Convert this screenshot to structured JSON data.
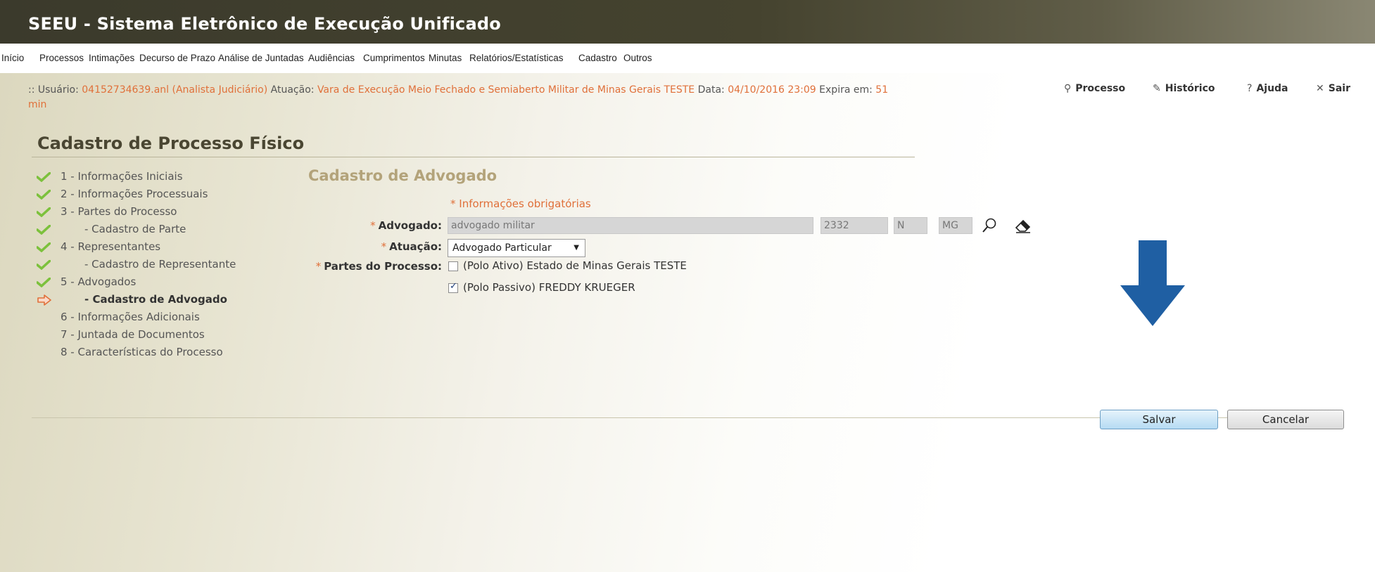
{
  "app": {
    "title": "SEEU - Sistema Eletrônico de Execução Unificado"
  },
  "menu": [
    "Início",
    "Processos",
    "Intimações",
    "Decurso de Prazo",
    "Análise de Juntadas",
    "Audiências",
    "Cumprimentos",
    "Minutas",
    "Relatórios/Estatísticas",
    "Cadastro",
    "Outros"
  ],
  "userbar": {
    "prefix": ":: Usuário:",
    "user": "04152734639.anl (Analista Judiciário)",
    "atuacao_label": "Atuação:",
    "atuacao": "Vara de Execução Meio Fechado e Semiaberto Militar de Minas Gerais TESTE",
    "data_label": "Data:",
    "data": "04/10/2016 23:09",
    "expira_label": "Expira em:",
    "expira": "51",
    "min": "min",
    "links": {
      "processo": "Processo",
      "historico": "Histórico",
      "ajuda": "Ajuda",
      "sair": "Sair"
    }
  },
  "page_title": "Cadastro de Processo Físico",
  "steps": [
    {
      "label": "1 - Informações Iniciais",
      "status": "done"
    },
    {
      "label": "2 - Informações Processuais",
      "status": "done"
    },
    {
      "label": "3 - Partes do Processo",
      "status": "done"
    },
    {
      "label": "- Cadastro de Parte",
      "status": "done"
    },
    {
      "label": "4 - Representantes",
      "status": "done"
    },
    {
      "label": "- Cadastro de Representante",
      "status": "done"
    },
    {
      "label": "5 - Advogados",
      "status": "done"
    },
    {
      "label": "- Cadastro de Advogado",
      "status": "current"
    },
    {
      "label": "6 - Informações Adicionais",
      "status": "pending"
    },
    {
      "label": "7 - Juntada de Documentos",
      "status": "pending"
    },
    {
      "label": "8 - Características do Processo",
      "status": "pending"
    }
  ],
  "form": {
    "section_title": "Cadastro de Advogado",
    "required_note": "* Informações obrigatórias",
    "advogado_label": "Advogado:",
    "advogado_value": "advogado militar",
    "oab_number": "2332",
    "oab_letter": "N",
    "oab_uf": "MG",
    "atuacao_label": "Atuação:",
    "atuacao_value": "Advogado Particular",
    "partes_label": "Partes do Processo:",
    "partes": [
      {
        "label": "(Polo Ativo) Estado de Minas Gerais TESTE",
        "checked": false
      },
      {
        "label": "(Polo Passivo) FREDDY KRUEGER",
        "checked": true
      }
    ]
  },
  "buttons": {
    "save": "Salvar",
    "cancel": "Cancelar"
  },
  "colors": {
    "accent_orange": "#e0703a",
    "header_dark": "#3b3a2c",
    "arrow_blue": "#1f5fa3"
  }
}
